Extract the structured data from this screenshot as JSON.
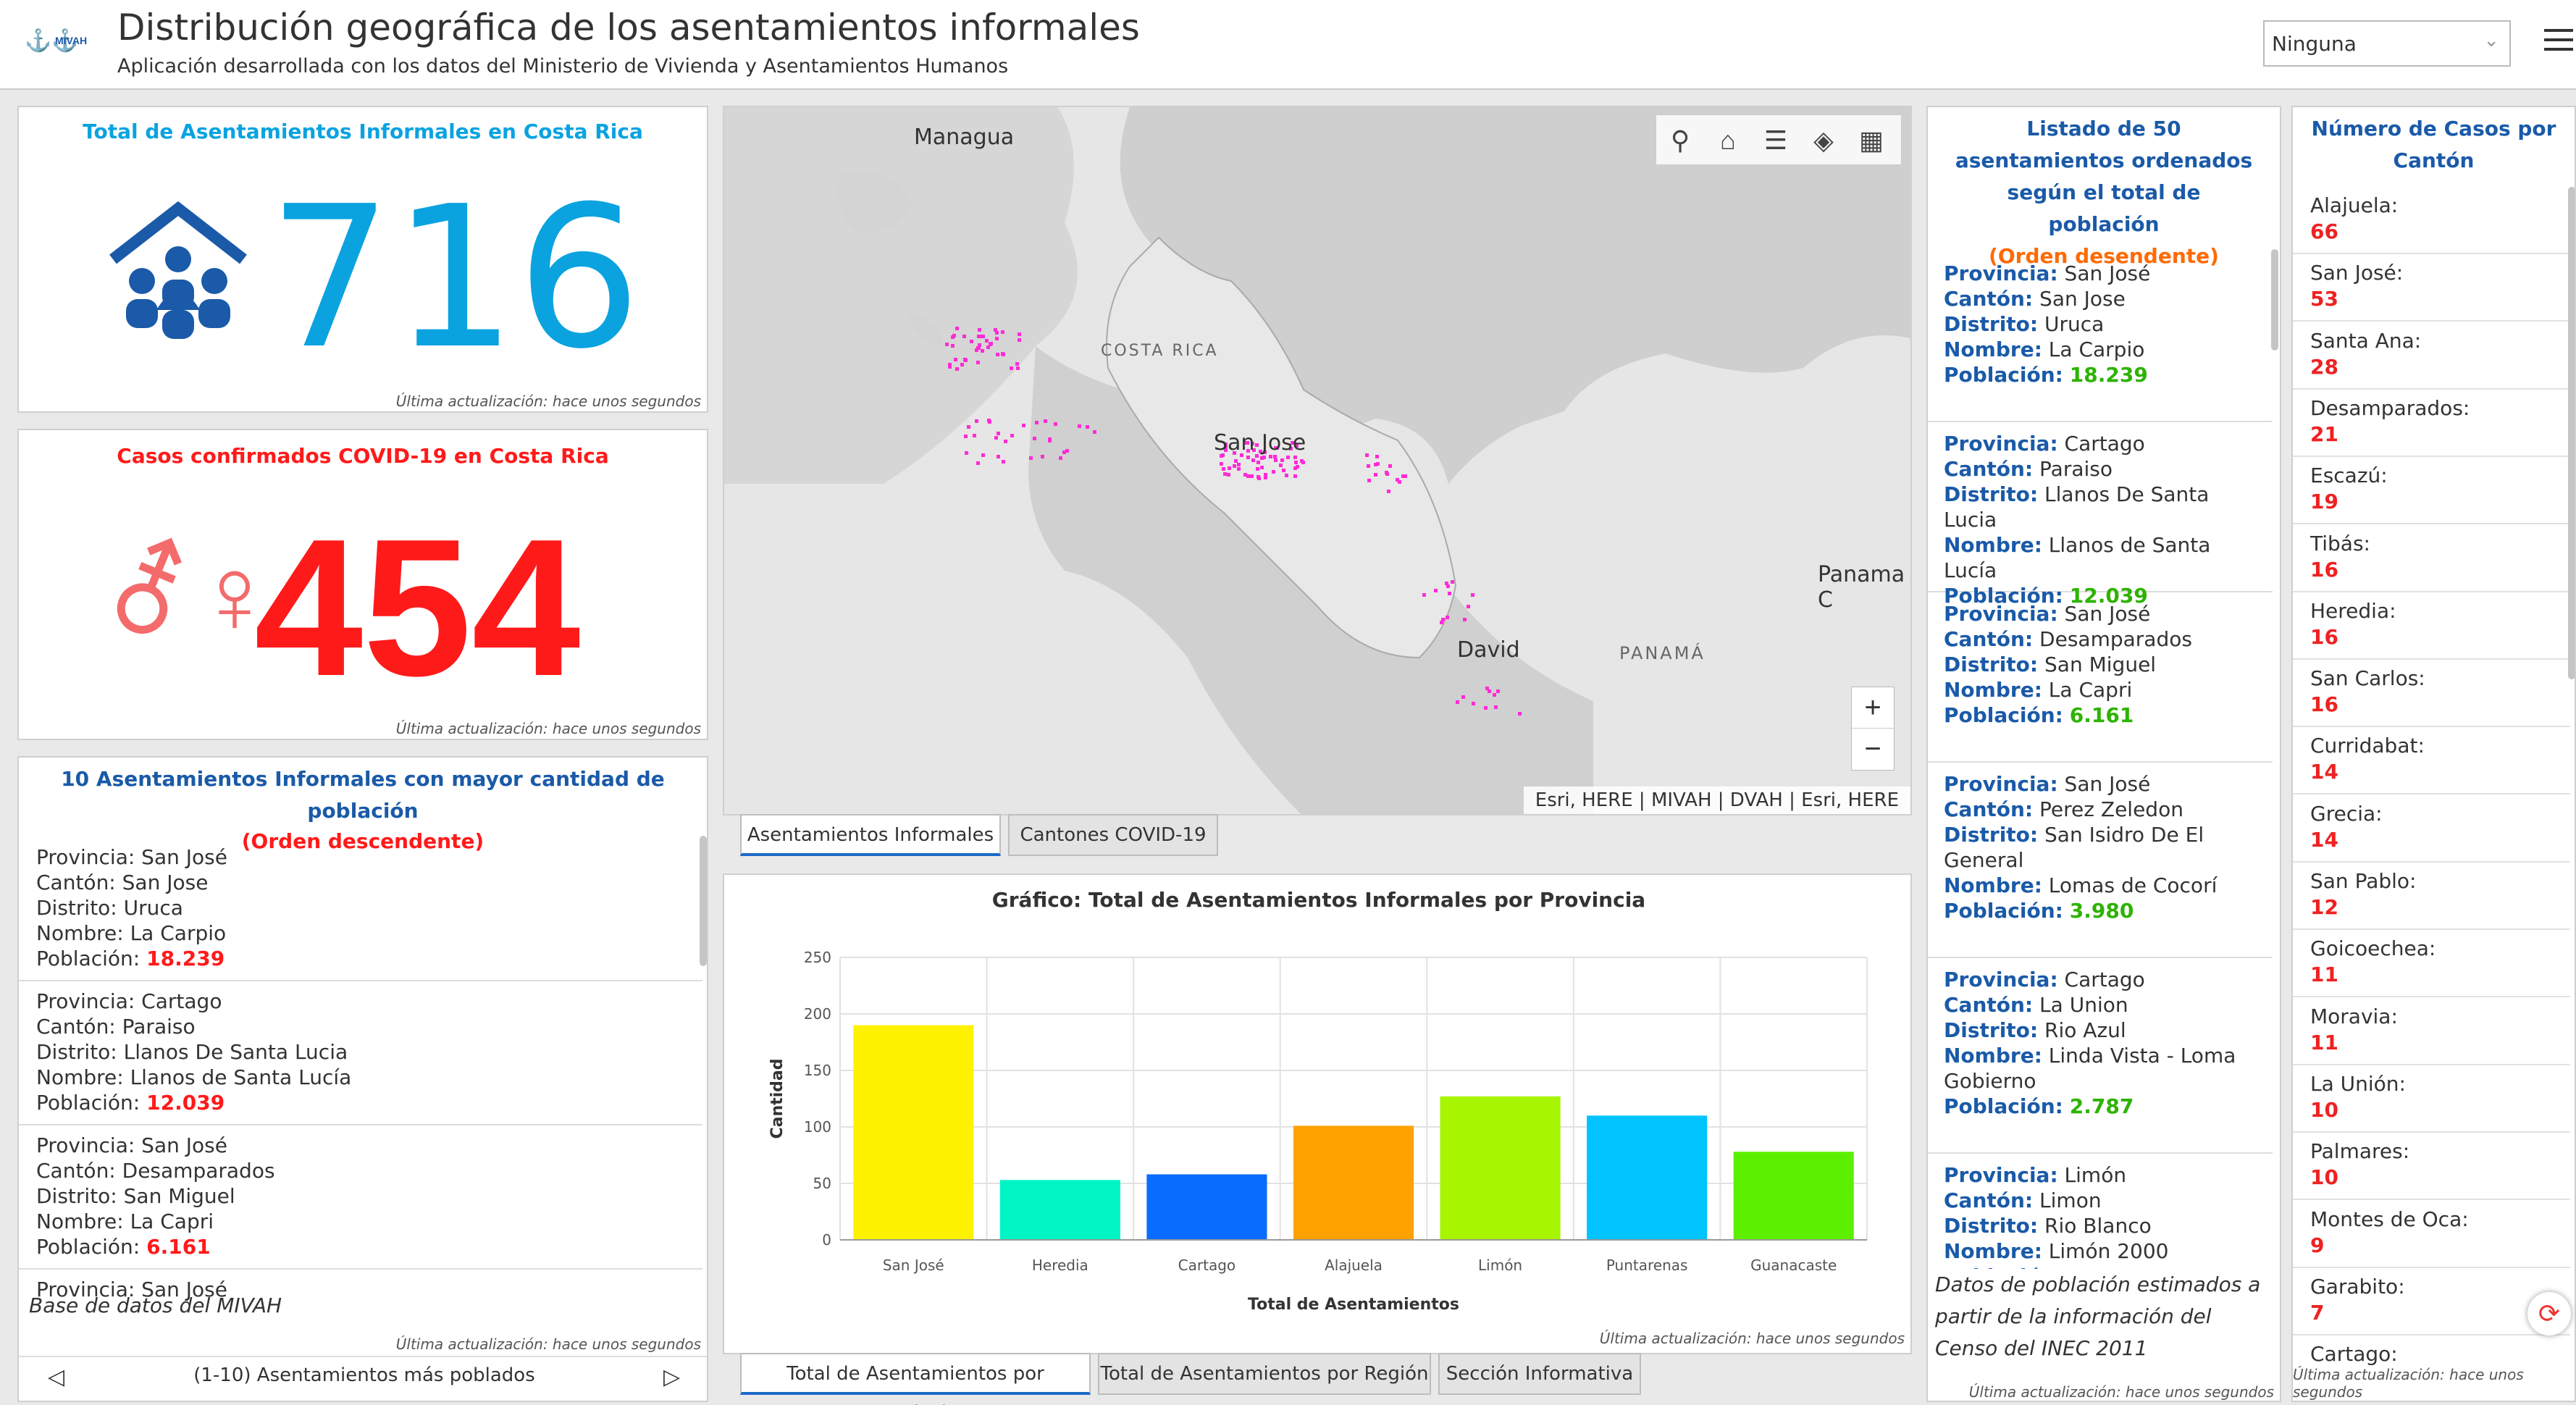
{
  "header": {
    "logo": "MIVAH",
    "title": "Distribución geográfica de los asentamientos informales",
    "subtitle": "Aplicación desarrollada con los datos del Ministerio de Vivienda y Asentamientos Humanos",
    "select_value": "Ninguna",
    "menu_icon": "hamburger-icon"
  },
  "colors": {
    "blue": "#1a5aa8",
    "cyan": "#0aa3e0",
    "red": "#ff1a1a",
    "orange": "#ff6a00",
    "green": "#2db300"
  },
  "updated": "Última actualización: hace unos segundos",
  "total": {
    "title": "Total de Asentamientos Informales en Costa Rica",
    "value": "716",
    "icon": "people-house-icon"
  },
  "covid": {
    "title": "Casos confirmados COVID-19 en Costa Rica",
    "value": "454",
    "icon": "gender-icon"
  },
  "top10": {
    "title": "10 Asentamientos Informales con mayor cantidad de población",
    "order": "(Orden descendente)",
    "items": [
      {
        "provincia": "Provincia: San José",
        "canton": "Cantón: San Jose",
        "distrito": "Distrito: Uruca",
        "nombre": "Nombre: La Carpio",
        "pob_label": "Población: ",
        "pob": "18.239"
      },
      {
        "provincia": "Provincia: Cartago",
        "canton": "Cantón: Paraiso",
        "distrito": "Distrito: Llanos De Santa Lucia",
        "nombre": "Nombre: Llanos de Santa Lucía",
        "pob_label": "Población: ",
        "pob": "12.039"
      },
      {
        "provincia": "Provincia: San José",
        "canton": "Cantón: Desamparados",
        "distrito": "Distrito: San Miguel",
        "nombre": "Nombre: La Capri",
        "pob_label": "Población: ",
        "pob": "6.161"
      },
      {
        "provincia": "Provincia: San José",
        "canton": "",
        "distrito": "",
        "nombre": "",
        "pob_label": "",
        "pob": ""
      }
    ],
    "footer_note": "Base de datos del MIVAH",
    "pager": "(1-10) Asentamientos más poblados"
  },
  "map": {
    "labels": {
      "managua": "Managua",
      "costa_rica": "COSTA RICA",
      "san_jose": "San Jose",
      "panama_city": "Panama C",
      "david": "David",
      "panama": "PANAMÁ"
    },
    "attribution": "Esri, HERE | MIVAH | DVAH | Esri, HERE",
    "zoom_in": "+",
    "zoom_out": "−",
    "toolbar": [
      "search-icon",
      "home-icon",
      "list-icon",
      "layers-icon",
      "basemap-gallery-icon"
    ]
  },
  "map_tabs": [
    "Asentamientos Informales",
    "Cantones COVID-19"
  ],
  "chart_tabs": [
    "Total de Asentamientos por Provincia",
    "Total de Asentamientos por Región",
    "Sección Informativa"
  ],
  "chart_data": {
    "type": "bar",
    "title": "Gráfico: Total de Asentamientos Informales por Provincia",
    "xlabel": "Total de Asentamientos",
    "ylabel": "Cantidad",
    "ylim": [
      0,
      250
    ],
    "yticks": [
      0,
      50,
      100,
      150,
      200,
      250
    ],
    "grid": true,
    "categories": [
      "San José",
      "Heredia",
      "Cartago",
      "Alajuela",
      "Limón",
      "Puntarenas",
      "Guanacaste"
    ],
    "values": [
      190,
      53,
      58,
      101,
      127,
      110,
      78
    ],
    "colors": [
      "#fff200",
      "#00f5c4",
      "#0a6cff",
      "#ffa200",
      "#a8f500",
      "#00c3ff",
      "#5cf000"
    ]
  },
  "list50": {
    "title": "Listado de 50 asentamientos ordenados según el total de población",
    "order": "(Orden desendente)",
    "items": [
      {
        "lines": [
          [
            "Provincia:",
            "San José"
          ],
          [
            "Cantón:",
            "San Jose"
          ],
          [
            "Distrito:",
            "Uruca"
          ],
          [
            "Nombre:",
            "La Carpio"
          ]
        ],
        "pob": "18.239"
      },
      {
        "lines": [
          [
            "Provincia:",
            "Cartago"
          ],
          [
            "Cantón:",
            "Paraiso"
          ],
          [
            "Distrito:",
            "Llanos De Santa Lucia"
          ],
          [
            "Nombre:",
            "Llanos de Santa Lucía"
          ]
        ],
        "pob": "12.039"
      },
      {
        "lines": [
          [
            "Provincia:",
            "San José"
          ],
          [
            "Cantón:",
            "Desamparados"
          ],
          [
            "Distrito:",
            "San Miguel"
          ],
          [
            "Nombre:",
            "La Capri"
          ]
        ],
        "pob": "6.161"
      },
      {
        "lines": [
          [
            "Provincia:",
            "San José"
          ],
          [
            "Cantón:",
            "Perez Zeledon"
          ],
          [
            "Distrito:",
            "San Isidro De El"
          ],
          [
            "",
            "General"
          ],
          [
            "Nombre:",
            "Lomas de Cocorí"
          ]
        ],
        "pob": "3.980"
      },
      {
        "lines": [
          [
            "Provincia:",
            "Cartago"
          ],
          [
            "Cantón:",
            "La Union"
          ],
          [
            "Distrito:",
            "Rio Azul"
          ],
          [
            "Nombre:",
            "Linda Vista - Loma"
          ],
          [
            "",
            "Gobierno"
          ]
        ],
        "pob": "2.787"
      },
      {
        "lines": [
          [
            "Provincia:",
            "Limón"
          ],
          [
            "Cantón:",
            "Limon"
          ],
          [
            "Distrito:",
            "Rio Blanco"
          ],
          [
            "Nombre:",
            "Limón 2000"
          ]
        ],
        "pob": ""
      }
    ],
    "pob_label": "Población:",
    "note": "Datos de población estimados a partir de la información del Censo del INEC 2011"
  },
  "cantones": {
    "title": "Número de Casos por Cantón",
    "items": [
      [
        "Alajuela:",
        "66"
      ],
      [
        "San José:",
        "53"
      ],
      [
        "Santa Ana:",
        "28"
      ],
      [
        "Desamparados:",
        "21"
      ],
      [
        "Escazú:",
        "19"
      ],
      [
        "Tibás:",
        "16"
      ],
      [
        "Heredia:",
        "16"
      ],
      [
        "San Carlos:",
        "16"
      ],
      [
        "Curridabat:",
        "14"
      ],
      [
        "Grecia:",
        "14"
      ],
      [
        "San Pablo:",
        "12"
      ],
      [
        "Goicoechea:",
        "11"
      ],
      [
        "Moravia:",
        "11"
      ],
      [
        "La Unión:",
        "10"
      ],
      [
        "Palmares:",
        "10"
      ],
      [
        "Montes de Oca:",
        "9"
      ],
      [
        "Garabito:",
        "7"
      ],
      [
        "Cartago:",
        ""
      ]
    ]
  }
}
